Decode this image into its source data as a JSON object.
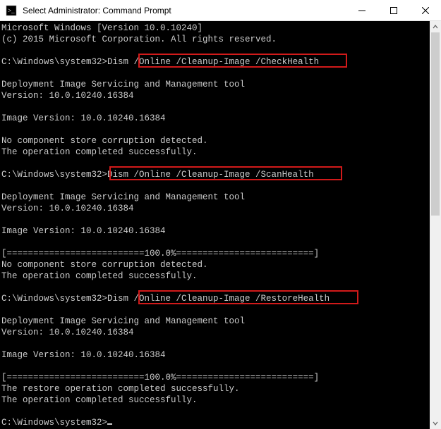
{
  "window": {
    "title": "Select Administrator: Command Prompt",
    "icon_name": "cmd-icon"
  },
  "controls": {
    "minimize": "Minimize",
    "maximize": "Maximize",
    "close": "Close"
  },
  "terminal": {
    "lines": [
      "Microsoft Windows [Version 10.0.10240]",
      "(c) 2015 Microsoft Corporation. All rights reserved.",
      "",
      "C:\\Windows\\system32>Dism /Online /Cleanup-Image /CheckHealth",
      "",
      "Deployment Image Servicing and Management tool",
      "Version: 10.0.10240.16384",
      "",
      "Image Version: 10.0.10240.16384",
      "",
      "No component store corruption detected.",
      "The operation completed successfully.",
      "",
      "C:\\Windows\\system32>Dism /Online /Cleanup-Image /ScanHealth",
      "",
      "Deployment Image Servicing and Management tool",
      "Version: 10.0.10240.16384",
      "",
      "Image Version: 10.0.10240.16384",
      "",
      "[==========================100.0%==========================]",
      "No component store corruption detected.",
      "The operation completed successfully.",
      "",
      "C:\\Windows\\system32>Dism /Online /Cleanup-Image /RestoreHealth",
      "",
      "Deployment Image Servicing and Management tool",
      "Version: 10.0.10240.16384",
      "",
      "Image Version: 10.0.10240.16384",
      "",
      "[==========================100.0%==========================]",
      "The restore operation completed successfully.",
      "The operation completed successfully.",
      "",
      "C:\\Windows\\system32>"
    ]
  },
  "highlights": [
    {
      "text": "/Online /Cleanup-Image /CheckHealth"
    },
    {
      "text": "Dism /Online /Cleanup-Image /ScanHealth"
    },
    {
      "text": "/Online /Cleanup-Image /RestoreHealth"
    }
  ],
  "colors": {
    "terminal_bg": "#000000",
    "terminal_fg": "#cccccc",
    "highlight_border": "#d21a1a"
  }
}
